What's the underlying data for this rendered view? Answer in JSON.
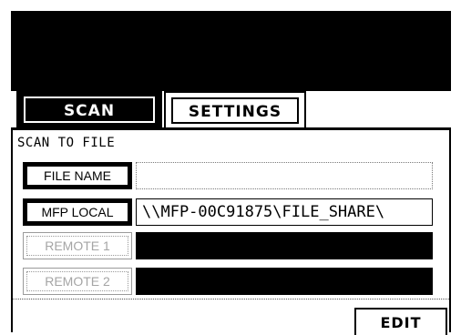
{
  "tabs": {
    "scan": "SCAN",
    "settings": "SETTINGS"
  },
  "section_title": "SCAN TO FILE",
  "rows": [
    {
      "button_label": "FILE NAME",
      "value": "",
      "enabled": true
    },
    {
      "button_label": "MFP LOCAL",
      "value": "\\\\MFP-00C91875\\FILE_SHARE\\",
      "enabled": true
    },
    {
      "button_label": "REMOTE 1",
      "value": "",
      "enabled": false
    },
    {
      "button_label": "REMOTE 2",
      "value": "",
      "enabled": false
    }
  ],
  "footer": {
    "edit_label": "EDIT"
  }
}
